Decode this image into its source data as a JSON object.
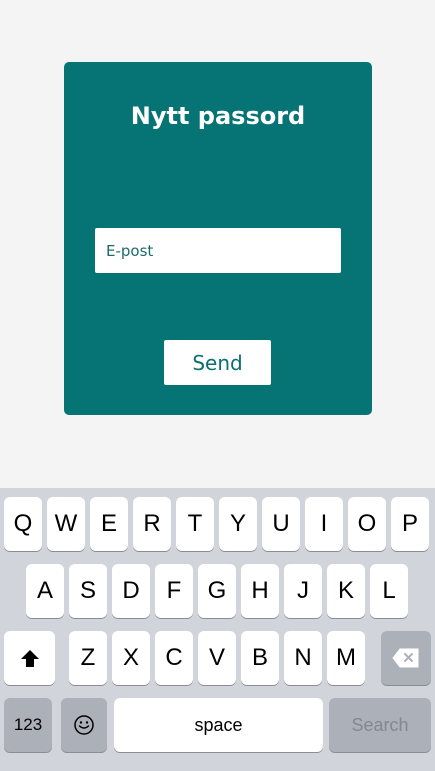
{
  "card": {
    "title": "Nytt passord",
    "email_placeholder": "E-post",
    "send_label": "Send"
  },
  "keyboard": {
    "row1": [
      "Q",
      "W",
      "E",
      "R",
      "T",
      "Y",
      "U",
      "I",
      "O",
      "P"
    ],
    "row2": [
      "A",
      "S",
      "D",
      "F",
      "G",
      "H",
      "J",
      "K",
      "L"
    ],
    "row3": [
      "Z",
      "X",
      "C",
      "V",
      "B",
      "N",
      "M"
    ],
    "numbers_label": "123",
    "space_label": "space",
    "search_label": "Search"
  },
  "icons": {
    "shift": "shift-icon",
    "backspace": "backspace-icon",
    "emoji": "emoji-icon"
  },
  "colors": {
    "card": "#067474",
    "page_background": "#f4f4f4",
    "keyboard_background": "#d1d4da",
    "key": "#ffffff",
    "dark_key": "#acb1b9",
    "teal_text": "#0b6f6f"
  }
}
